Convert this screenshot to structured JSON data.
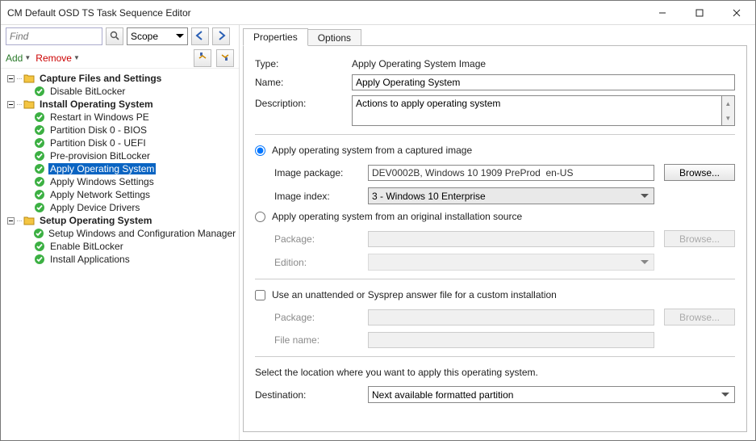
{
  "window": {
    "title": "CM Default OSD TS Task Sequence Editor"
  },
  "toolbar": {
    "find_placeholder": "Find",
    "scope": "Scope",
    "add": "Add",
    "remove": "Remove"
  },
  "tree": {
    "group1": {
      "label": "Capture Files and Settings"
    },
    "item_disable_bitlocker": "Disable BitLocker",
    "group2": {
      "label": "Install Operating System"
    },
    "item_restart_pe": "Restart in Windows PE",
    "item_part_bios": "Partition Disk 0 - BIOS",
    "item_part_uefi": "Partition Disk 0 - UEFI",
    "item_preprov": "Pre-provision BitLocker",
    "item_apply_os": "Apply Operating System",
    "item_apply_win": "Apply Windows Settings",
    "item_apply_net": "Apply Network Settings",
    "item_apply_drv": "Apply Device Drivers",
    "group3": {
      "label": "Setup Operating System"
    },
    "item_setup_cm": "Setup Windows and Configuration Manager",
    "item_enable_bl": "Enable BitLocker",
    "item_install_apps": "Install Applications"
  },
  "tabs": {
    "properties": "Properties",
    "options": "Options"
  },
  "form": {
    "type_label": "Type:",
    "type_value": "Apply Operating System Image",
    "name_label": "Name:",
    "name_value": "Apply Operating System",
    "desc_label": "Description:",
    "desc_value": "Actions to apply operating system",
    "radio_captured": "Apply operating system from a captured image",
    "image_package_label": "Image package:",
    "image_package_value": "DEV0002B, Windows 10 1909 PreProd  en-US",
    "browse": "Browse...",
    "image_index_label": "Image index:",
    "image_index_value": "3 - Windows 10 Enterprise",
    "radio_original": "Apply operating system from an original installation source",
    "package_label": "Package:",
    "edition_label": "Edition:",
    "unattend_label": "Use an unattended or Sysprep answer file for a custom installation",
    "filename_label": "File name:",
    "dest_intro": "Select the location where you want to apply this operating system.",
    "dest_label": "Destination:",
    "dest_value": "Next available formatted partition"
  }
}
